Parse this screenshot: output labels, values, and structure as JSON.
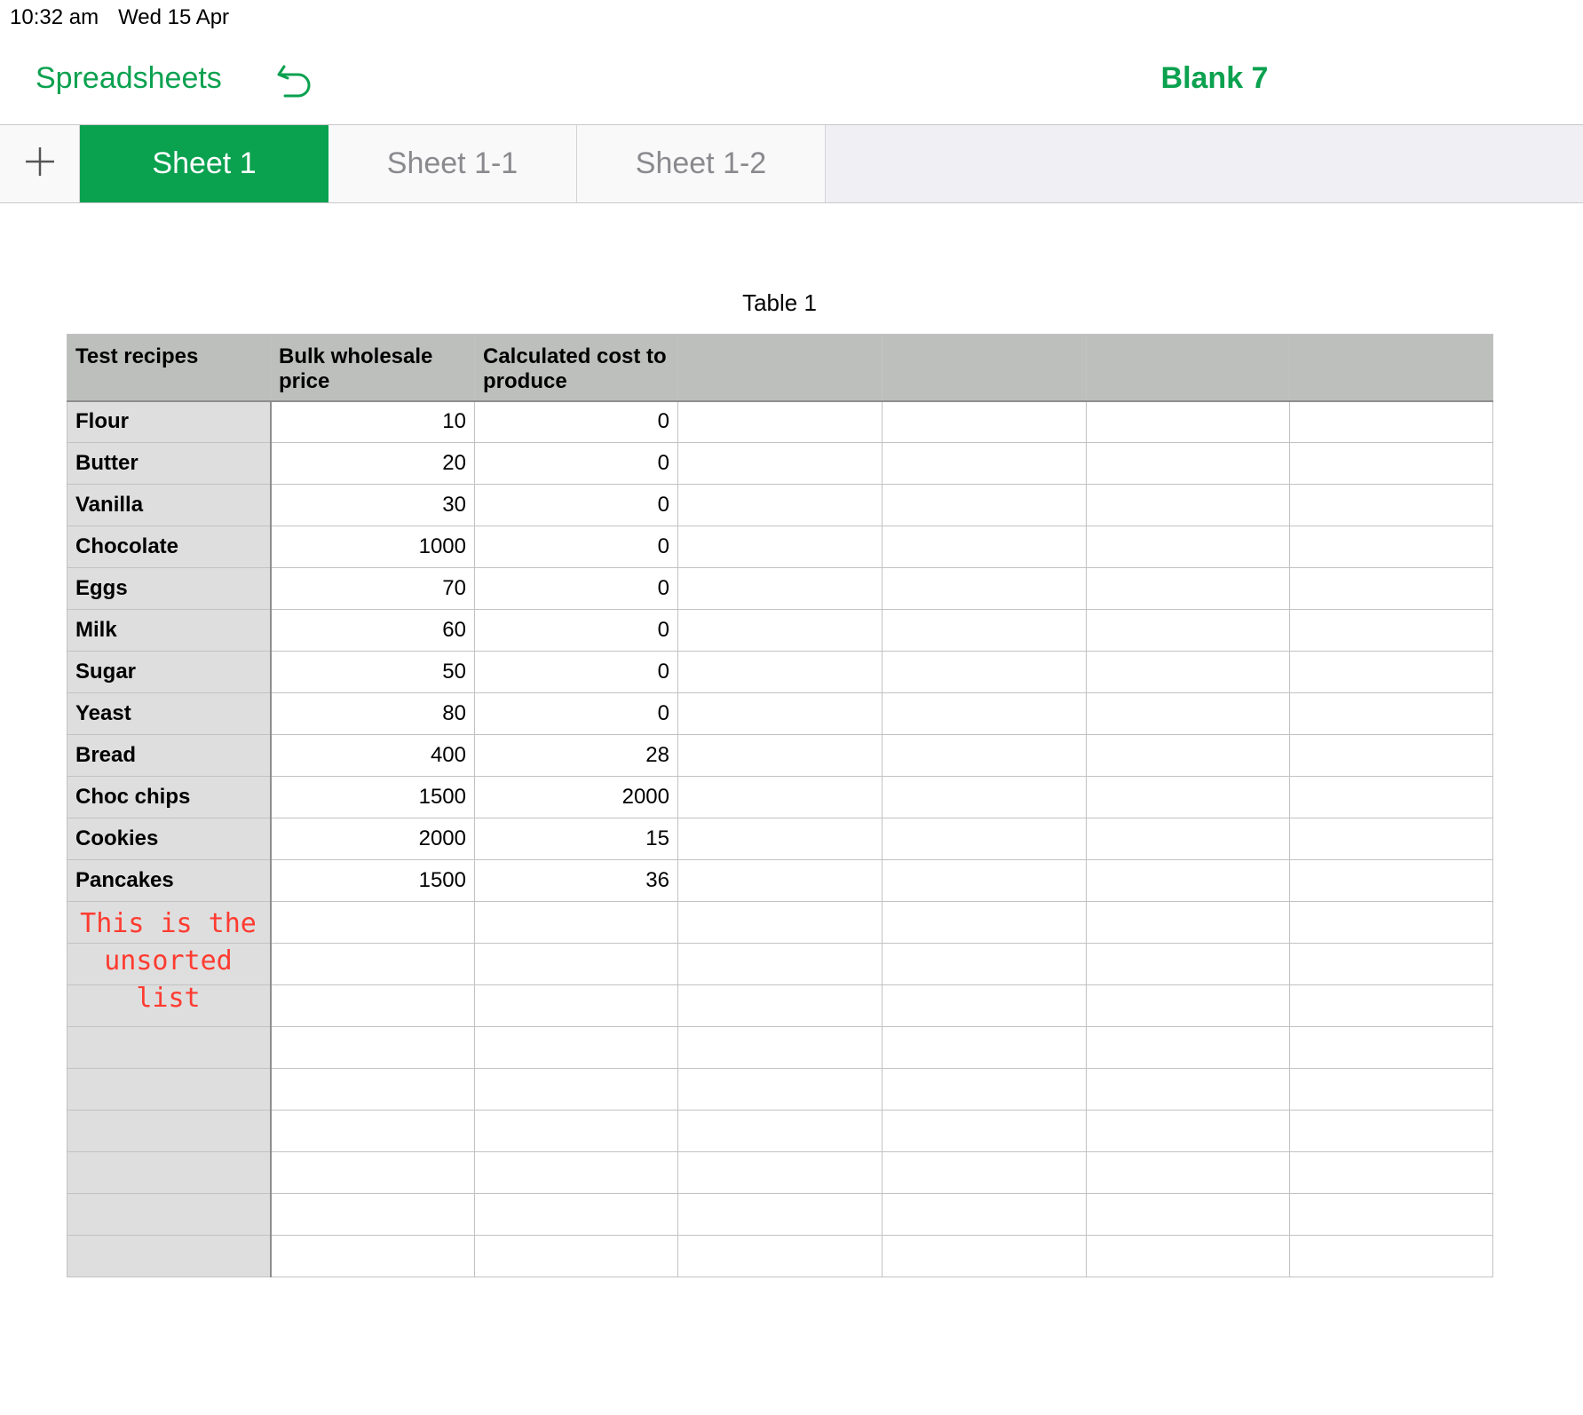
{
  "status_bar": {
    "time": "10:32 am",
    "date": "Wed 15 Apr"
  },
  "nav": {
    "back_label": "Spreadsheets",
    "title": "Blank 7"
  },
  "tabs": [
    {
      "label": "Sheet 1",
      "active": true
    },
    {
      "label": "Sheet 1-1",
      "active": false
    },
    {
      "label": "Sheet 1-2",
      "active": false
    }
  ],
  "icons": {
    "undo": "undo-icon",
    "add": "plus-icon"
  },
  "colors": {
    "accent": "#0aa14f",
    "note": "#ff3b30",
    "header_bg": "#bdbfbd",
    "rowhead_bg": "#dedede"
  },
  "table": {
    "title": "Table 1",
    "headers": [
      "Test recipes",
      "Bulk wholesale price",
      "Calculated cost to produce",
      "",
      "",
      "",
      ""
    ],
    "rows": [
      [
        "Flour",
        "10",
        "0"
      ],
      [
        "Butter",
        "20",
        "0"
      ],
      [
        "Vanilla",
        "30",
        "0"
      ],
      [
        "Chocolate",
        "1000",
        "0"
      ],
      [
        "Eggs",
        "70",
        "0"
      ],
      [
        "Milk",
        "60",
        "0"
      ],
      [
        "Sugar",
        "50",
        "0"
      ],
      [
        "Yeast",
        "80",
        "0"
      ],
      [
        "Bread",
        "400",
        "28"
      ],
      [
        "Choc chips",
        "1500",
        "2000"
      ],
      [
        "Cookies",
        "2000",
        "15"
      ],
      [
        "Pancakes",
        "1500",
        "36"
      ],
      [
        "",
        "",
        ""
      ],
      [
        "",
        "",
        ""
      ],
      [
        "",
        "",
        ""
      ],
      [
        "",
        "",
        ""
      ],
      [
        "",
        "",
        ""
      ],
      [
        "",
        "",
        ""
      ],
      [
        "",
        "",
        ""
      ],
      [
        "",
        "",
        ""
      ],
      [
        "",
        "",
        ""
      ]
    ]
  },
  "annotation": {
    "line1": "This is the",
    "line2": "unsorted list"
  }
}
